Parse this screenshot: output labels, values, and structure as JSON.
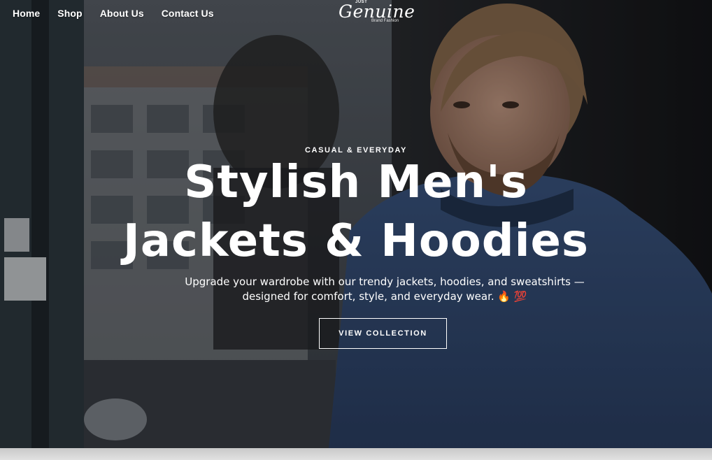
{
  "nav": {
    "items": [
      {
        "label": "Home"
      },
      {
        "label": "Shop"
      },
      {
        "label": "About Us"
      },
      {
        "label": "Contact Us"
      }
    ]
  },
  "logo": {
    "top_text": "JUST",
    "script_text": "Genuine",
    "sub_text": "Brand Fashion"
  },
  "hero": {
    "eyebrow": "CASUAL & EVERYDAY",
    "headline_line1": "Stylish Men's",
    "headline_line2": "Jackets & Hoodies",
    "description": "Upgrade your wardrobe with our trendy jackets, hoodies, and sweatshirts —designed for comfort, style, and everyday wear. 🔥 💯",
    "cta_label": "VIEW COLLECTION"
  },
  "colors": {
    "text": "#ffffff",
    "hoodie": "#2e4468",
    "overlay": "#1b1d22"
  }
}
